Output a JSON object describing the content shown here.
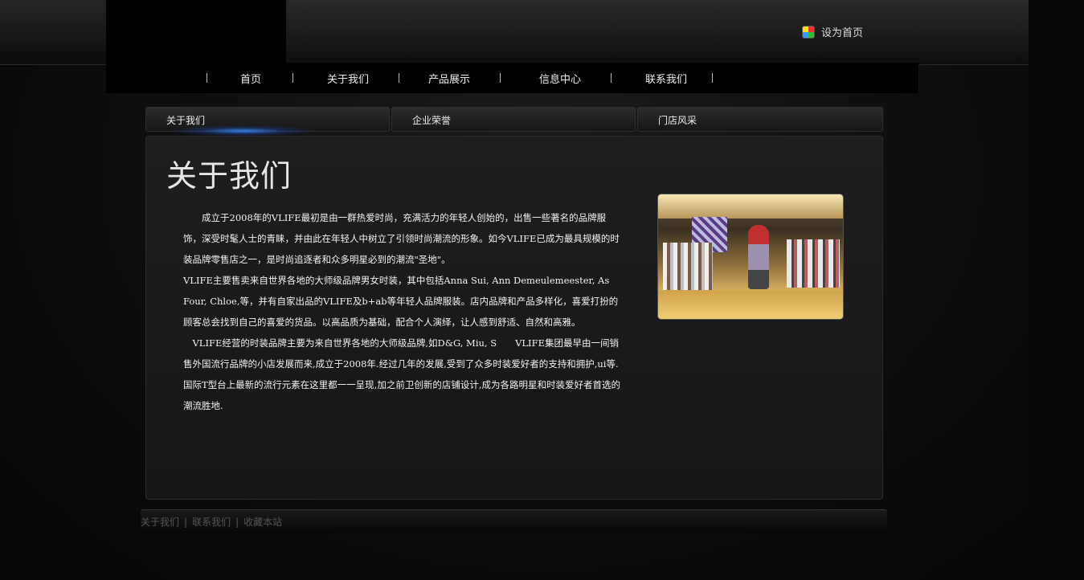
{
  "header": {
    "set_homepage": "设为首页"
  },
  "nav": {
    "items": [
      "首页",
      "关于我们",
      "产品展示",
      "信息中心",
      "联系我们"
    ]
  },
  "tabs": [
    "关于我们",
    "企业荣誉",
    "门店风采"
  ],
  "content": {
    "title": "关于我们",
    "paragraphs": [
      "　　成立于2008年的VLIFE最初是由一群热爱时尚，充满活力的年轻人创始的，出售一些著名的品牌服饰，深受时髦人士的青睐，并由此在年轻人中树立了引领时尚潮流的形象。如今VLIFE已成为最具规模的时 装品牌零售店之一，是时尚追逐者和众多明星必到的潮流\"圣地\"。",
      "VLIFE主要售卖来自世界各地的大师级品牌男女时装，其中包括Anna Sui, Ann Demeulemeester, As Four, Chloe,等，并有自家出品的VLIFE及b+ab等年轻人品牌服装。店内品牌和产品多样化，喜爱打扮的顾客总会找到自己的喜爱的货品。以高品质为基础，配合个人演绎，让人感到舒适、自然和高雅。",
      "　VLIFE经营的时装品牌主要为来自世界各地的大师级品牌,如D&G, Miu, S　　VLIFE集团最早由一间销售外国流行品牌的小店发展而来,成立于2008年.经过几年的发展,受到了众多时装爱好者的支持和拥护,ui等.国际T型台上最新的流行元素在这里都一一呈现,加之前卫创新的店铺设计,成为各路明星和时装爱好者首选的潮流胜地."
    ]
  },
  "footer": {
    "links": [
      "关于我们",
      "联系我们",
      "收藏本站"
    ],
    "separator": "|"
  }
}
